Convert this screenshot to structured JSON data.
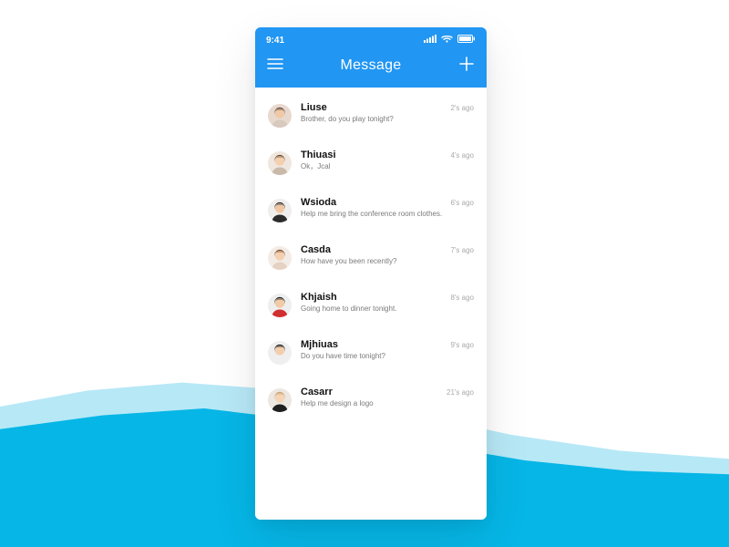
{
  "status": {
    "time": "9:41"
  },
  "header": {
    "title": "Message"
  },
  "conversations": [
    {
      "name": "Liuse",
      "preview": "Brother, do you play tonight?",
      "time": "2's ago",
      "avatar": {
        "bg": "#e8d9cf",
        "shirt": "#d8c9bf",
        "hair": "#5a4234",
        "skin": "#f1c9a6"
      }
    },
    {
      "name": "Thiuasi",
      "preview": "Ok，Jcal",
      "time": "4's ago",
      "avatar": {
        "bg": "#efe7df",
        "shirt": "#c9b9a9",
        "hair": "#6a4a2a",
        "skin": "#f3cfae"
      }
    },
    {
      "name": "Wsioda",
      "preview": "Help me bring the conference room clothes.",
      "time": "6's ago",
      "avatar": {
        "bg": "#f0eeec",
        "shirt": "#2b2b2b",
        "hair": "#2b2b2b",
        "skin": "#f1c6a3"
      }
    },
    {
      "name": "Casda",
      "preview": "How have you been recently?",
      "time": "7's ago",
      "avatar": {
        "bg": "#f3ece6",
        "shirt": "#e6d2c3",
        "hair": "#7a4a25",
        "skin": "#f4cfb0"
      }
    },
    {
      "name": "Khjaish",
      "preview": "Going home to dinner tonight.",
      "time": "8's ago",
      "avatar": {
        "bg": "#eeeeee",
        "shirt": "#d12f2f",
        "hair": "#1a1a1a",
        "skin": "#f2caa6"
      }
    },
    {
      "name": "Mjhiuas",
      "preview": "Do you have time tonight?",
      "time": "9's ago",
      "avatar": {
        "bg": "#efefef",
        "shirt": "#efefef",
        "hair": "#1a1a1a",
        "skin": "#f3cead"
      }
    },
    {
      "name": "Casarr",
      "preview": "Help me design a logo",
      "time": "21's ago",
      "avatar": {
        "bg": "#ece7e1",
        "shirt": "#1f1f1f",
        "hair": "#caa06a",
        "skin": "#f4d4b6"
      }
    }
  ]
}
